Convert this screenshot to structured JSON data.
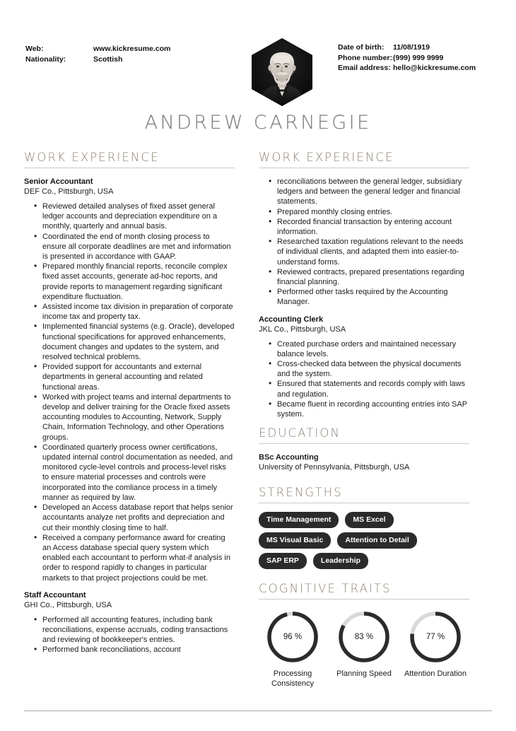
{
  "name": "ANDREW CARNEGIE",
  "contact_left": [
    {
      "label": "Web:",
      "value": "www.kickresume.com"
    },
    {
      "label": "Nationality:",
      "value": "Scottish"
    }
  ],
  "contact_right": [
    {
      "label": "Date of birth:",
      "value": "11/08/1919"
    },
    {
      "label": "Phone number:",
      "value": "(999) 999 9999"
    },
    {
      "label": "Email address:",
      "value": "hello@kickresume.com"
    }
  ],
  "photo": {
    "alt": "portrait-photo"
  },
  "sections": {
    "work_experience_left": "WORK EXPERIENCE",
    "work_experience_right": "WORK EXPERIENCE",
    "education": "EDUCATION",
    "strengths": "STRENGTHS",
    "cognitive_traits": "COGNITIVE TRAITS"
  },
  "jobs_left": [
    {
      "title": "Senior Accountant",
      "sub": "DEF Co., Pittsburgh, USA",
      "bullets": [
        "Reviewed detailed analyses of fixed asset general ledger accounts and depreciation expenditure on a monthly, quarterly and annual basis.",
        "Coordinated the end of month closing process to ensure all corporate deadlines are met and information is presented in accordance with GAAP.",
        "Prepared monthly financial reports, reconcile complex fixed asset accounts, generate ad-hoc reports, and provide reports to management regarding significant expenditure fluctuation.",
        "Assisted income tax division in preparation of corporate income tax and property tax.",
        "Implemented financial systems (e.g. Oracle), developed functional specifications for approved enhancements, document changes and updates to the system, and resolved technical problems.",
        "Provided support for accountants and external departments in general accounting and related functional areas.",
        "Worked with project teams and internal departments to develop and deliver training for the Oracle fixed assets accounting modules to Accounting, Network, Supply Chain, Information Technology, and other Operations groups.",
        "Coordinated quarterly process owner certifications, updated internal control documentation as needed, and monitored cycle-level controls and process-level risks to ensure material processes and controls were incorporated into the comliance process in a timely manner as required by law.",
        "Developed an Access database report that helps senior accountants analyze net profits and depreciation and cut their monthly closing time to half.",
        "Received a company performance award for creating an Access database special query system which enabled each accountant to perform what-if analysis in order to respond rapidly to changes in particular markets to that project projections could be met."
      ]
    },
    {
      "title": "Staff Accountant",
      "sub": "GHI Co., Pittsburgh, USA",
      "bullets": [
        "Performed all accounting features, including bank reconciliations, expense accruals, coding transactions and reviewing of bookkeeper's entries.",
        "Performed bank reconciliations, account"
      ]
    }
  ],
  "jobs_right": [
    {
      "title": "",
      "sub": "",
      "continuation": "reconciliations between the general ledger, subsidiary ledgers and between the general ledger and financial statements.",
      "bullets": [
        "Prepared monthly closing entries.",
        "Recorded financial transaction by entering account information.",
        "Researched taxation regulations relevant to the needs of individual clients, and adapted them into easier-to-understand forms.",
        "Reviewed contracts, prepared presentations regarding financial planning.",
        "Performed other tasks required by the Accounting Manager."
      ]
    },
    {
      "title": "Accounting Clerk",
      "sub": "JKL Co., Pittsburgh, USA",
      "bullets": [
        "Created purchase orders and maintained necessary balance levels.",
        "Cross-checked data between the physical documents and the system.",
        "Ensured that statements and records comply with laws and regulation.",
        "Became fluent in recording accounting entries into SAP system."
      ]
    }
  ],
  "education": [
    {
      "title": "BSc Accounting",
      "sub": "University of Pennsylvania, Pittsburgh, USA"
    }
  ],
  "strengths": [
    "Time Management",
    "MS Excel",
    "MS Visual Basic",
    "Attention to Detail",
    "SAP ERP",
    "Leadership"
  ],
  "chart_data": {
    "type": "pie",
    "title": "COGNITIVE TRAITS",
    "categories": [
      "Processing Consistency",
      "Planning Speed",
      "Attention Duration"
    ],
    "values": [
      96,
      83,
      77
    ],
    "unit": "%",
    "value_labels": [
      "96 %",
      "83 %",
      "77 %"
    ],
    "colors": {
      "fill": "#2b2b2b",
      "track": "#d8d8d8"
    },
    "ylim": [
      0,
      100
    ]
  },
  "colors": {
    "section_header": "#8d8274",
    "name": "#7d7d7d",
    "tag_bg": "#2b2b2b",
    "text": "#1a1a1a",
    "rule": "#cfcac2"
  }
}
